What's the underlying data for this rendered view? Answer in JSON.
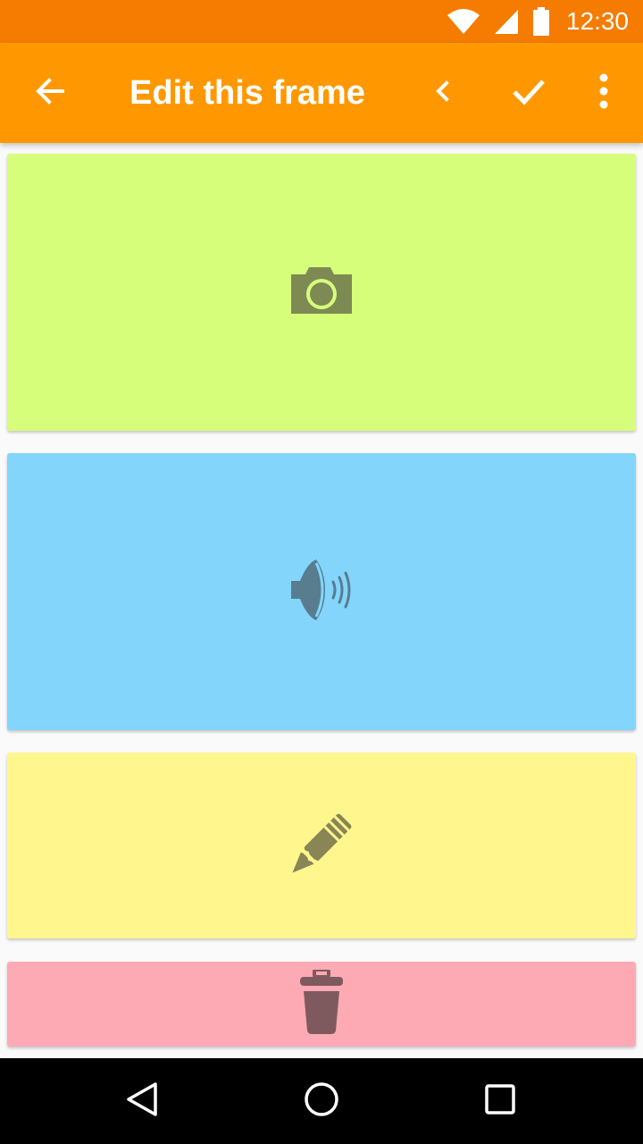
{
  "status_bar": {
    "time": "12:30",
    "icons": [
      "wifi-icon",
      "signal-icon",
      "battery-icon"
    ],
    "color": "#f57c00"
  },
  "app_bar": {
    "title": "Edit this frame",
    "color": "#ff9800",
    "actions": [
      "back-arrow-icon",
      "chevron-left-icon",
      "check-icon",
      "more-vert-icon"
    ]
  },
  "cards": [
    {
      "name": "photo",
      "icon": "camera-icon",
      "color": "#d7fe7b"
    },
    {
      "name": "audio",
      "icon": "speaker-icon",
      "color": "#83d5fc"
    },
    {
      "name": "text",
      "icon": "pencil-icon",
      "color": "#fff78e"
    },
    {
      "name": "delete",
      "icon": "trash-icon",
      "color": "#feaab4"
    }
  ],
  "nav_bar": {
    "buttons": [
      "back-triangle-icon",
      "home-circle-icon",
      "recents-square-icon"
    ]
  }
}
